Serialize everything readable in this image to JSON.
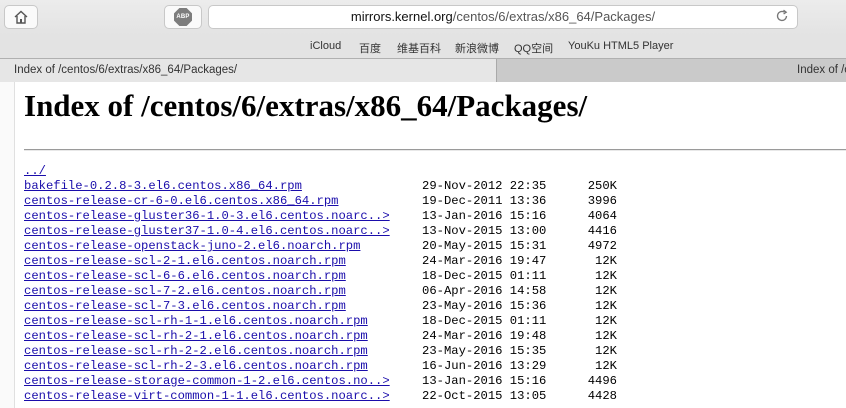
{
  "browser": {
    "url_domain": "mirrors.kernel.org",
    "url_path": "/centos/6/extras/x86_64/Packages/",
    "abp_label": "ABP",
    "bookmarks": [
      "iCloud",
      "百度",
      "维基百科",
      "新浪微博",
      "QQ空间",
      "YouKu HTML5 Player"
    ],
    "tabs": [
      {
        "label": "Index of /centos/6/extras/x86_64/Packages/"
      },
      {
        "label": "Index of /c"
      }
    ]
  },
  "page": {
    "title": "Index of /centos/6/extras/x86_64/Packages/",
    "parent_link": "../",
    "entries": [
      {
        "name": "bakefile-0.2.8-3.el6.centos.x86_64.rpm",
        "date": "29-Nov-2012 22:35",
        "size": "250K"
      },
      {
        "name": "centos-release-cr-6-0.el6.centos.x86_64.rpm",
        "date": "19-Dec-2011 13:36",
        "size": "3996"
      },
      {
        "name": "centos-release-gluster36-1.0-3.el6.centos.noarc..>",
        "date": "13-Jan-2016 15:16",
        "size": "4064"
      },
      {
        "name": "centos-release-gluster37-1.0-4.el6.centos.noarc..>",
        "date": "13-Nov-2015 13:00",
        "size": "4416"
      },
      {
        "name": "centos-release-openstack-juno-2.el6.noarch.rpm",
        "date": "20-May-2015 15:31",
        "size": "4972"
      },
      {
        "name": "centos-release-scl-2-1.el6.centos.noarch.rpm",
        "date": "24-Mar-2016 19:47",
        "size": "12K"
      },
      {
        "name": "centos-release-scl-6-6.el6.centos.noarch.rpm",
        "date": "18-Dec-2015 01:11",
        "size": "12K"
      },
      {
        "name": "centos-release-scl-7-2.el6.centos.noarch.rpm",
        "date": "06-Apr-2016 14:58",
        "size": "12K"
      },
      {
        "name": "centos-release-scl-7-3.el6.centos.noarch.rpm",
        "date": "23-May-2016 15:36",
        "size": "12K"
      },
      {
        "name": "centos-release-scl-rh-1-1.el6.centos.noarch.rpm",
        "date": "18-Dec-2015 01:11",
        "size": "12K"
      },
      {
        "name": "centos-release-scl-rh-2-1.el6.centos.noarch.rpm",
        "date": "24-Mar-2016 19:48",
        "size": "12K"
      },
      {
        "name": "centos-release-scl-rh-2-2.el6.centos.noarch.rpm",
        "date": "23-May-2016 15:35",
        "size": "12K"
      },
      {
        "name": "centos-release-scl-rh-2-3.el6.centos.noarch.rpm",
        "date": "16-Jun-2016 13:29",
        "size": "12K"
      },
      {
        "name": "centos-release-storage-common-1-2.el6.centos.no..>",
        "date": "13-Jan-2016 15:16",
        "size": "4496"
      },
      {
        "name": "centos-release-virt-common-1-1.el6.centos.noarc..>",
        "date": "22-Oct-2015 13:05",
        "size": "4428"
      }
    ]
  }
}
